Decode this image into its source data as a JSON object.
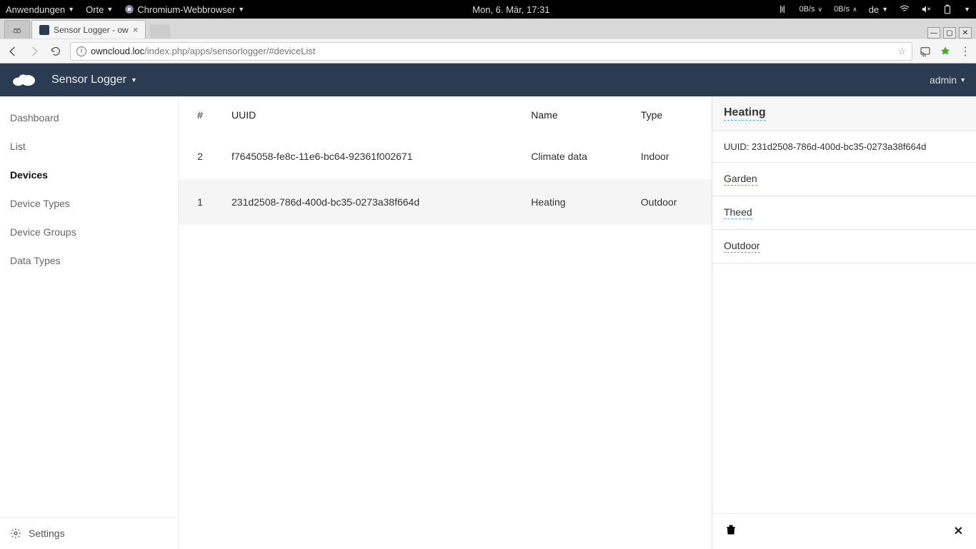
{
  "gnome": {
    "apps": "Anwendungen",
    "places": "Orte",
    "browser": "Chromium-Webbrowser",
    "clock": "Mon, 6. Mär, 17:31",
    "net_down": "0B/s",
    "net_up": "0B/s",
    "lang": "de"
  },
  "browser": {
    "tab_title": "Sensor Logger - ow",
    "url_host": "owncloud.loc",
    "url_path": "/index.php/apps/sensorlogger/#deviceList"
  },
  "app": {
    "title": "Sensor Logger",
    "user": "admin"
  },
  "sidebar": {
    "items": [
      {
        "label": "Dashboard"
      },
      {
        "label": "List"
      },
      {
        "label": "Devices"
      },
      {
        "label": "Device Types"
      },
      {
        "label": "Device Groups"
      },
      {
        "label": "Data Types"
      }
    ],
    "settings": "Settings"
  },
  "table": {
    "headers": {
      "num": "#",
      "uuid": "UUID",
      "name": "Name",
      "type": "Type"
    },
    "rows": [
      {
        "num": "2",
        "uuid": "f7645058-fe8c-11e6-bc64-92361f002671",
        "name": "Climate data",
        "type": "Indoor",
        "selected": false
      },
      {
        "num": "1",
        "uuid": "231d2508-786d-400d-bc35-0273a38f664d",
        "name": "Heating",
        "type": "Outdoor",
        "selected": true
      }
    ]
  },
  "detail": {
    "title": "Heating",
    "uuid_label": "UUID:",
    "uuid": "231d2508-786d-400d-bc35-0273a38f664d",
    "fields": [
      {
        "value": "Garden"
      },
      {
        "value": "Theed"
      },
      {
        "value": "Outdoor"
      }
    ]
  }
}
